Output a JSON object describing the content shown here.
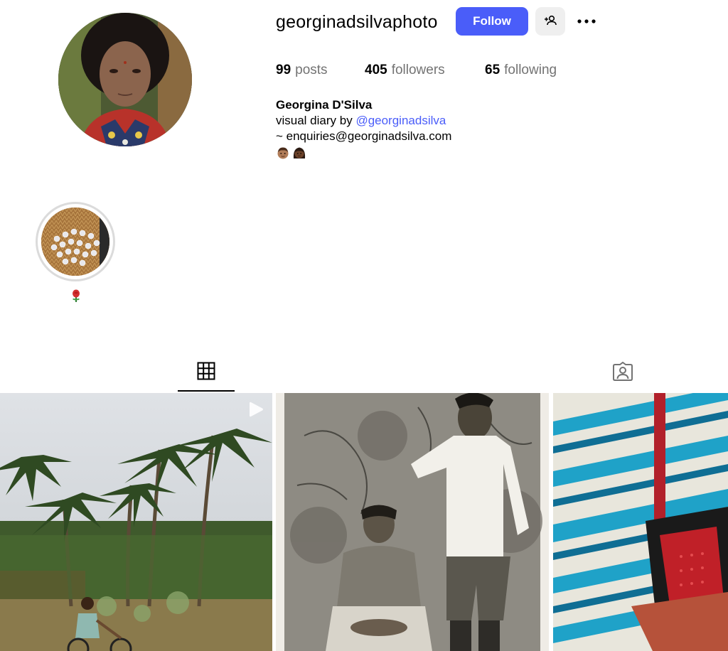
{
  "profile": {
    "username": "georginadsilvaphoto",
    "follow_label": "Follow",
    "stats": {
      "posts_count": "99",
      "posts_label": "posts",
      "followers_count": "405",
      "followers_label": "followers",
      "following_count": "65",
      "following_label": "following"
    },
    "bio": {
      "name": "Georgina D'Silva",
      "line1_prefix": "visual diary by ",
      "mention": "@georginadsilva",
      "line2": "~ enquiries@georginadsilva.com"
    }
  },
  "highlights": [
    {
      "label_icon": "rose-icon"
    }
  ],
  "tabs": [
    {
      "icon": "grid-icon",
      "active": true
    },
    {
      "icon": "tagged-icon",
      "active": false
    }
  ],
  "posts": [
    {
      "type": "video",
      "subject": "palm-trees-boy-on-bicycle"
    },
    {
      "type": "photo",
      "subject": "vintage-couple-portrait"
    },
    {
      "type": "photo",
      "subject": "striped-fabric-chair"
    }
  ],
  "colors": {
    "accent": "#4a5df9",
    "secondary_button": "#efefef",
    "muted_text": "#737373",
    "highlight_ring": "#dbdbdb"
  }
}
